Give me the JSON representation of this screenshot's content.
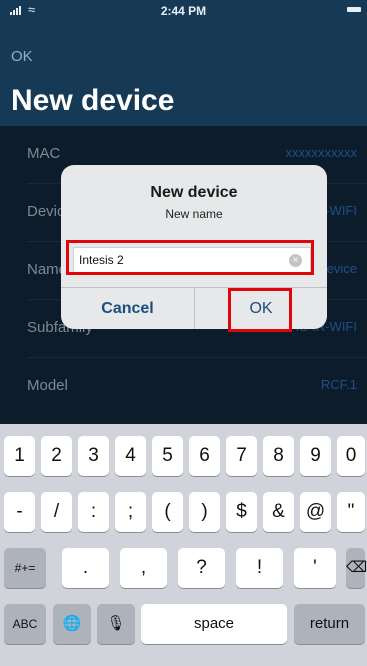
{
  "status_bar": {
    "time": "2:44 PM"
  },
  "nav": {
    "ok_label": "OK",
    "title": "New device"
  },
  "rows": [
    {
      "label": "MAC",
      "value": "xxxxxxxxxxx"
    },
    {
      "label": "Device",
      "value": "IS-IR-WIFI"
    },
    {
      "label": "Name",
      "value": "Intesis device"
    },
    {
      "label": "Subfamily",
      "value": "IS-IR-WIFI"
    },
    {
      "label": "Model",
      "value": "RCF.1"
    }
  ],
  "dialog": {
    "title": "New device",
    "message": "New name",
    "input_value": "Intesis 2",
    "cancel_label": "Cancel",
    "ok_label": "OK"
  },
  "keyboard": {
    "row1": [
      "1",
      "2",
      "3",
      "4",
      "5",
      "6",
      "7",
      "8",
      "9",
      "0"
    ],
    "row2": [
      "-",
      "/",
      ":",
      ";",
      "(",
      ")",
      "$",
      "&",
      "@",
      "\""
    ],
    "row3_mode": "#+=",
    "row3": [
      ".",
      ",",
      "?",
      "!",
      "'"
    ],
    "backspace_icon": "⌫",
    "abc": "ABC",
    "globe_icon": "🌐",
    "mic_icon": "🎙",
    "space": "space",
    "return": "return"
  }
}
